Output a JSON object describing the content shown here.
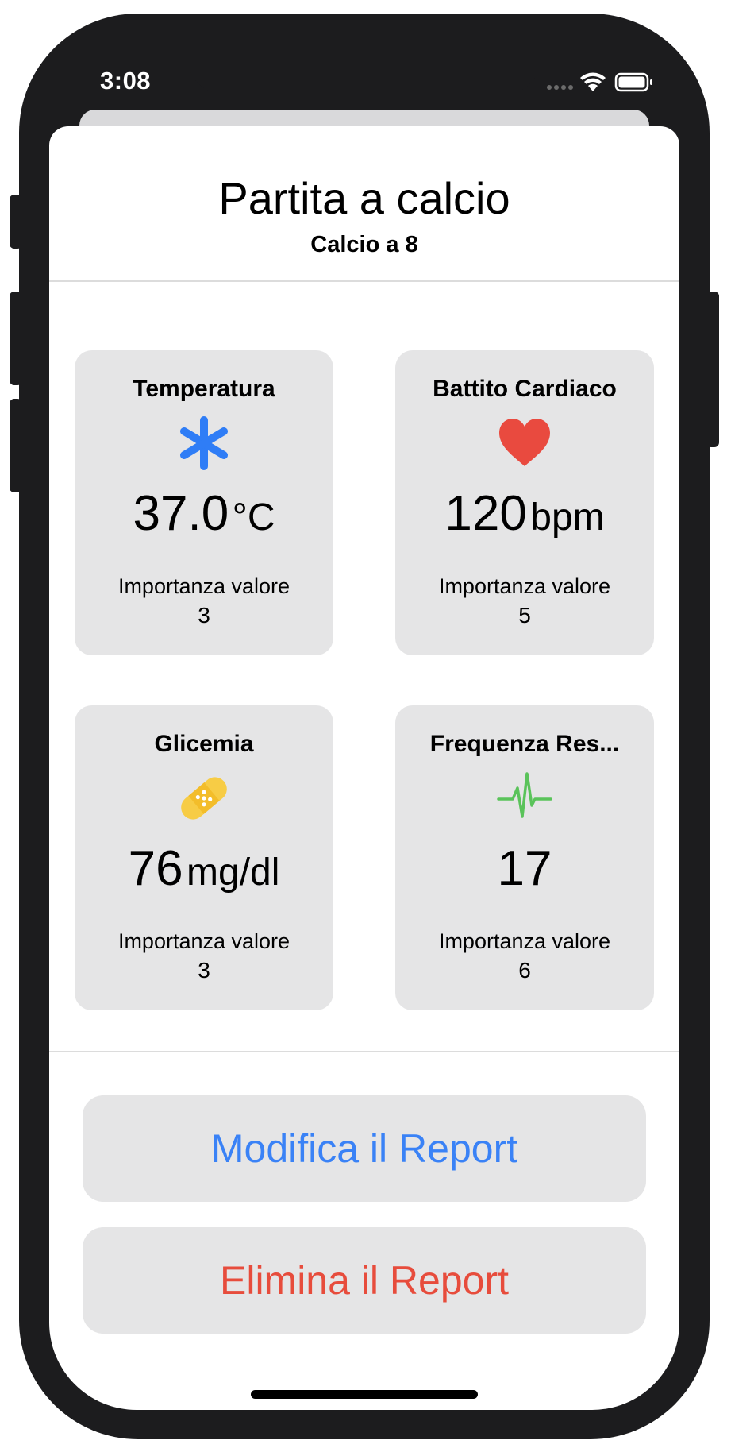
{
  "status_bar": {
    "time": "3:08"
  },
  "header": {
    "title": "Partita a calcio",
    "subtitle": "Calcio a 8"
  },
  "cards": [
    {
      "title": "Temperatura",
      "icon": "snowflake-asterisk-icon",
      "icon_color": "#2f7df6",
      "value": "37.0",
      "unit": "°C",
      "importance_label": "Importanza valore",
      "importance_value": "3"
    },
    {
      "title": "Battito Cardiaco",
      "icon": "heart-icon",
      "icon_color": "#e94a3f",
      "value": "120",
      "unit": "bpm",
      "importance_label": "Importanza valore",
      "importance_value": "5"
    },
    {
      "title": "Glicemia",
      "icon": "bandage-icon",
      "icon_color": "#f7cc45",
      "value": "76",
      "unit": "mg/dl",
      "importance_label": "Importanza valore",
      "importance_value": "3"
    },
    {
      "title": "Frequenza Res...",
      "icon": "waveform-pulse-icon",
      "icon_color": "#5ac35a",
      "value": "17",
      "unit": "",
      "importance_label": "Importanza valore",
      "importance_value": "6"
    }
  ],
  "actions": {
    "edit_label": "Modifica il Report",
    "edit_color": "#3a82f6",
    "delete_label": "Elimina il Report",
    "delete_color": "#e74c3c"
  }
}
